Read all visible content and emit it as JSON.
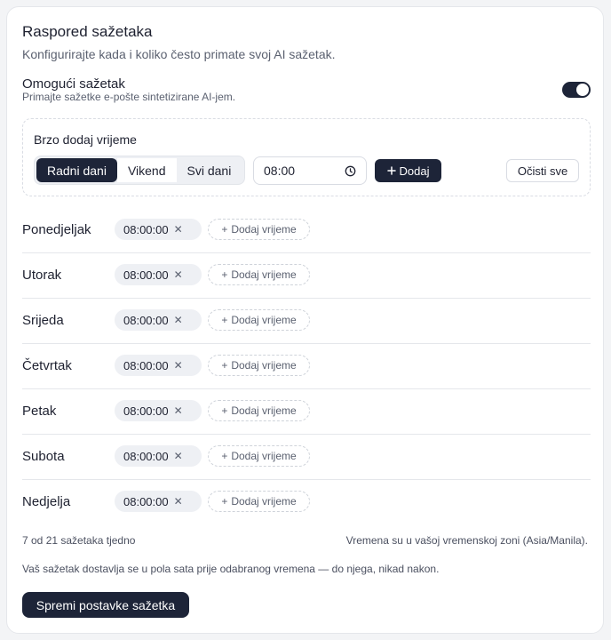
{
  "header": {
    "title": "Raspored sažetaka",
    "subtitle": "Konfigurirajte kada i koliko često primate svoj AI sažetak."
  },
  "enable": {
    "title": "Omogući sažetak",
    "subtitle": "Primajte sažetke e-pošte sintetizirane AI-jem.",
    "on": true
  },
  "quick_add": {
    "title": "Brzo dodaj vrijeme",
    "segments": [
      "Radni dani",
      "Vikend",
      "Svi dani"
    ],
    "selected_segment": "Radni dani",
    "time_value": "08:00",
    "add_label": "Dodaj",
    "clear_label": "Očisti sve"
  },
  "days": [
    {
      "name": "Ponedjeljak",
      "time": "08:00:00"
    },
    {
      "name": "Utorak",
      "time": "08:00:00"
    },
    {
      "name": "Srijeda",
      "time": "08:00:00"
    },
    {
      "name": "Četvrtak",
      "time": "08:00:00"
    },
    {
      "name": "Petak",
      "time": "08:00:00"
    },
    {
      "name": "Subota",
      "time": "08:00:00"
    },
    {
      "name": "Nedjelja",
      "time": "08:00:00"
    }
  ],
  "add_time_label": "Dodaj vrijeme",
  "footer": {
    "count": "7 od 21 sažetaka tjedno",
    "timezone": "Vremena su u vašoj vremenskoj zoni (Asia/Manila).",
    "note": "Vaš sažetak dostavlja se u pola sata prije odabranog vremena — do njega, nikad nakon.",
    "save_label": "Spremi postavke sažetka"
  },
  "colors": {
    "accent": "#1d2438",
    "chip_bg": "#eef0f4",
    "border": "#e5e7eb"
  }
}
